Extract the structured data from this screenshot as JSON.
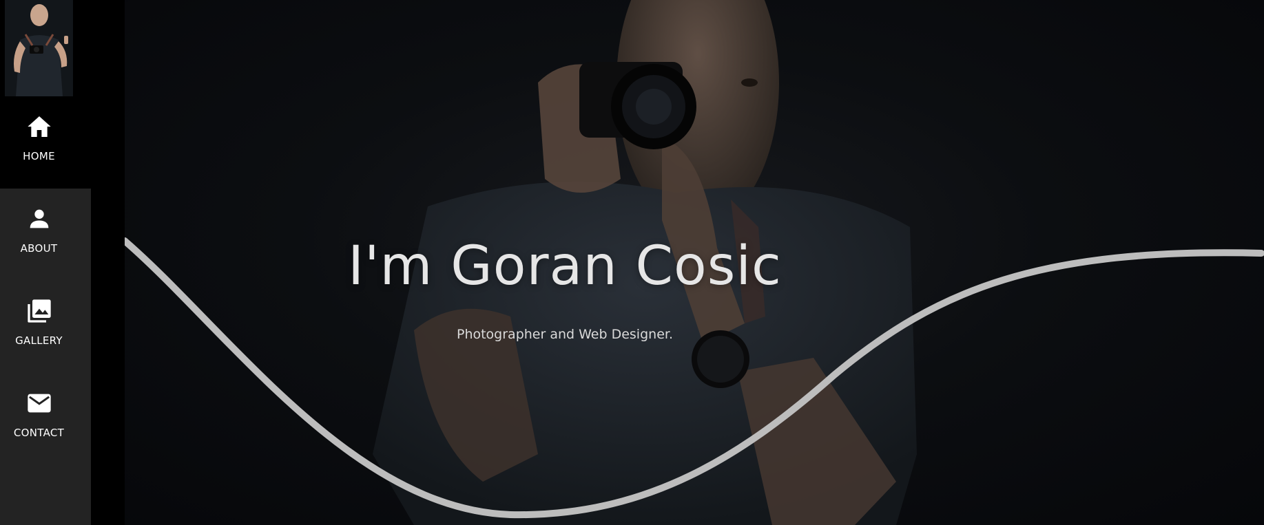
{
  "sidebar": {
    "avatar_alt": "Goran Cosic portrait",
    "items": [
      {
        "label": "HOME",
        "icon": "home-icon"
      },
      {
        "label": "ABOUT",
        "icon": "person-icon"
      },
      {
        "label": "GALLERY",
        "icon": "gallery-icon"
      },
      {
        "label": "CONTACT",
        "icon": "mail-icon"
      }
    ]
  },
  "hero": {
    "title": "I'm Goran Cosic",
    "subtitle": "Photographer and Web Designer."
  },
  "colors": {
    "sidebar_bg": "#000000",
    "nav_bg": "#232323",
    "text": "#ffffff",
    "wave": "#bdbdbd"
  }
}
